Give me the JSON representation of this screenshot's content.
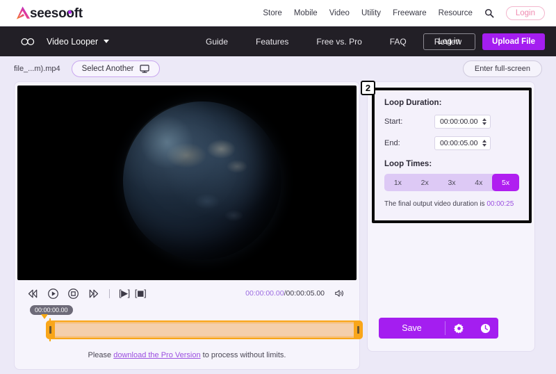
{
  "brand": {
    "name": "Aiseesoft",
    "accent": "#a41ef0",
    "logo_icon": "aiseesoft-a-logo"
  },
  "topnav": {
    "items": [
      {
        "label": "Store"
      },
      {
        "label": "Mobile"
      },
      {
        "label": "Video"
      },
      {
        "label": "Utility"
      },
      {
        "label": "Freeware"
      },
      {
        "label": "Resource"
      }
    ],
    "search_icon": "search-icon",
    "login_label": "Login"
  },
  "darkbar": {
    "loop_icon": "infinity-loop-icon",
    "product_label": "Video Looper",
    "caret_icon": "chevron-down-icon",
    "items": [
      {
        "label": "Guide"
      },
      {
        "label": "Features"
      },
      {
        "label": "Free vs. Pro"
      },
      {
        "label": "FAQ"
      },
      {
        "label": "Review"
      }
    ],
    "login_label": "Log in",
    "upload_label": "Upload File"
  },
  "filerow": {
    "filename": "file_...m).mp4",
    "select_another_label": "Select Another",
    "monitor_icon": "monitor-icon",
    "fullscreen_label": "Enter full-screen"
  },
  "player": {
    "video_description": "earth-at-night-globe",
    "controls": [
      {
        "name": "rewind-frame-icon",
        "glyph": "rewind"
      },
      {
        "name": "play-icon",
        "glyph": "play"
      },
      {
        "name": "stop-icon",
        "glyph": "stop"
      },
      {
        "name": "forward-frame-icon",
        "glyph": "forward"
      }
    ],
    "set_start_label": "[▶]",
    "set_end_label": "[◼]",
    "current_time": "00:00:00.00",
    "separator": "/",
    "total_time": "00:00:05.00",
    "volume_icon": "volume-icon",
    "timeline_tooltip": "00:00:00.00"
  },
  "pro_note": {
    "prefix": "Please ",
    "link": "download the Pro Version",
    "suffix": " to process without limits."
  },
  "loop_panel": {
    "badge": "2",
    "duration_title": "Loop Duration:",
    "start_label": "Start:",
    "start_value": "00:00:00.00",
    "end_label": "End:",
    "end_value": "00:00:05.00",
    "loop_times_title": "Loop Times:",
    "loop_options": [
      {
        "label": "1x",
        "active": false
      },
      {
        "label": "2x",
        "active": false
      },
      {
        "label": "3x",
        "active": false
      },
      {
        "label": "4x",
        "active": false
      },
      {
        "label": "5x",
        "active": true
      }
    ],
    "final_prefix": "The final output video duration is ",
    "final_duration": "00:00:25"
  },
  "actions": {
    "save_label": "Save",
    "settings_icon": "gear-icon",
    "history_icon": "clock-icon"
  }
}
